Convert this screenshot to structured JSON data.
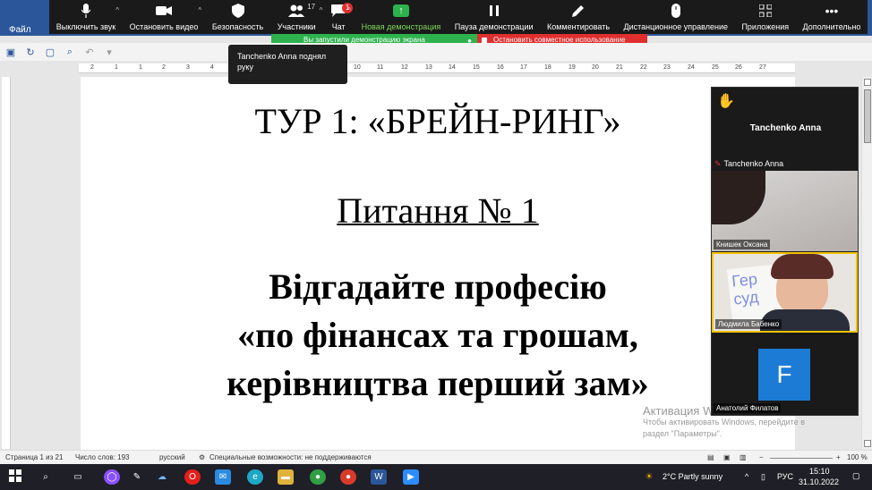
{
  "word": {
    "file_tab": "Файл"
  },
  "zoom_toolbar": {
    "buttons": [
      {
        "label": "Выключить звук",
        "icon": "mic-icon"
      },
      {
        "label": "Остановить видео",
        "icon": "video-camera-icon"
      },
      {
        "label": "Безопасность",
        "icon": "shield-icon"
      },
      {
        "label": "Участники",
        "icon": "participants-icon",
        "count": "17"
      },
      {
        "label": "Чат",
        "icon": "chat-icon",
        "badge": "1"
      },
      {
        "label": "Новая демонстрация",
        "icon": "share-screen-icon"
      },
      {
        "label": "Пауза демонстрации",
        "icon": "pause-icon"
      },
      {
        "label": "Комментировать",
        "icon": "pen-icon"
      },
      {
        "label": "Дистанционное управление",
        "icon": "mouse-icon"
      },
      {
        "label": "Приложения",
        "icon": "apps-icon"
      },
      {
        "label": "Дополнительно",
        "icon": "more-icon"
      }
    ]
  },
  "share_bar": {
    "notice": "Вы запустили демонстрацию экрана",
    "stop": "Остановить совместное использование"
  },
  "tooltip": {
    "text": "Tanchenko Anna поднял руку"
  },
  "ruler": {
    "ticks": [
      "2",
      "1",
      "1",
      "2",
      "3",
      "4",
      "5",
      "6",
      "7",
      "8",
      "9",
      "10",
      "11",
      "12",
      "13",
      "14",
      "15",
      "16",
      "17",
      "18",
      "19",
      "20",
      "21",
      "22",
      "23",
      "24",
      "25",
      "26",
      "27"
    ]
  },
  "document": {
    "title": "ТУР 1: «БРЕЙН-РИНГ»",
    "question": "Питання № 1",
    "body_line1": "Відгадайте професію",
    "body_line2": "«по фінансах та грошам,",
    "body_line3": "керівництва перший зам»"
  },
  "video_panel": {
    "raised_hand_name": "Tanchenko Anna",
    "muted_name": "Tanchenko Anna",
    "tiles": [
      {
        "name": "Книшек Оксана"
      },
      {
        "name": "Людмила Бабенко",
        "paper_text": "Гер суд"
      },
      {
        "name": "Анатолий Филатов",
        "initial": "F"
      }
    ]
  },
  "watermark": {
    "title": "Активация Windows",
    "line1": "Чтобы активировать Windows, перейдите в",
    "line2": "раздел \"Параметры\"."
  },
  "status_bar": {
    "page": "Страница 1 из 21",
    "words": "Число слов: 193",
    "language": "русский",
    "accessibility": "Специальные возможности: не поддерживаются",
    "zoom": "100 %"
  },
  "taskbar": {
    "weather": "2°C  Partly sunny",
    "lang": "РУС",
    "time": "15:10",
    "date": "31.10.2022"
  }
}
